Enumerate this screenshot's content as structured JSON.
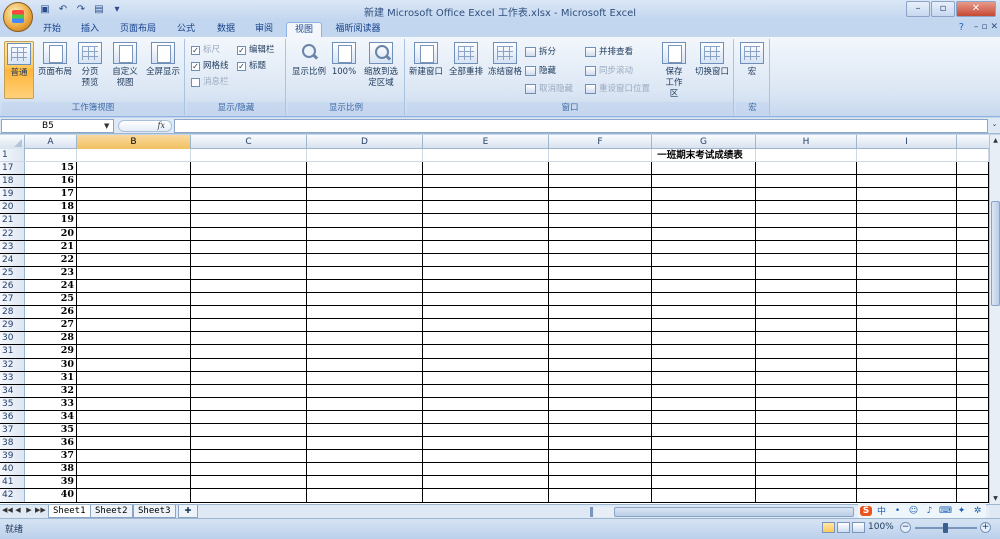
{
  "window": {
    "title": "新建 Microsoft Office Excel 工作表.xlsx - Microsoft Excel",
    "minimize": "–",
    "restore": "▫",
    "close": "✕"
  },
  "qat": {
    "save_icon": "save-icon",
    "undo_glyph": "↶",
    "redo_glyph": "↷",
    "print_glyph": "🖶",
    "more_glyph": "▾"
  },
  "tabs": [
    {
      "label": "开始"
    },
    {
      "label": "插入"
    },
    {
      "label": "页面布局"
    },
    {
      "label": "公式"
    },
    {
      "label": "数据"
    },
    {
      "label": "审阅"
    },
    {
      "label": "视图"
    },
    {
      "label": "福昕阅读器"
    }
  ],
  "active_tab": "视图",
  "help": "?",
  "ribbon": {
    "workbook_views": {
      "label": "工作簿视图",
      "normal": "普通",
      "page_layout": "页面布局",
      "page_break": "分页预览",
      "custom": "自定义视图",
      "fullscreen": "全屏显示"
    },
    "show_hide": {
      "label": "显示/隐藏",
      "ruler": "标尺",
      "gridlines": "网格线",
      "message_bar": "消息栏",
      "formula_bar": "编辑栏",
      "headings": "标题"
    },
    "zoom": {
      "label": "显示比例",
      "zoom": "显示比例",
      "zoom100": "100%",
      "zoom_selection": "缩放到选定区域"
    },
    "window": {
      "label": "窗口",
      "new_window": "新建窗口",
      "arrange_all": "全部重排",
      "freeze": "冻结窗格",
      "split": "拆分",
      "hide": "隐藏",
      "unhide": "取消隐藏",
      "side_by_side": "并排查看",
      "sync_scroll": "同步滚动",
      "reset_position": "重设窗口位置",
      "save_workspace": "保存工作区",
      "switch_windows": "切换窗口"
    },
    "macros": {
      "label": "宏",
      "macros": "宏"
    }
  },
  "formula_bar": {
    "name_box": "B5",
    "fx": "fx",
    "content": ""
  },
  "sheet": {
    "columns": [
      "A",
      "B",
      "C",
      "D",
      "E",
      "F",
      "G",
      "H",
      "I"
    ],
    "selected_column": "B",
    "title_text": "一班期末考试成绩表",
    "rows": [
      {
        "num": "1",
        "value": ""
      },
      {
        "num": "17",
        "value": "15"
      },
      {
        "num": "18",
        "value": "16"
      },
      {
        "num": "19",
        "value": "17"
      },
      {
        "num": "20",
        "value": "18"
      },
      {
        "num": "21",
        "value": "19"
      },
      {
        "num": "22",
        "value": "20"
      },
      {
        "num": "23",
        "value": "21"
      },
      {
        "num": "24",
        "value": "22"
      },
      {
        "num": "25",
        "value": "23"
      },
      {
        "num": "26",
        "value": "24"
      },
      {
        "num": "27",
        "value": "25"
      },
      {
        "num": "28",
        "value": "26"
      },
      {
        "num": "29",
        "value": "27"
      },
      {
        "num": "30",
        "value": "28"
      },
      {
        "num": "31",
        "value": "29"
      },
      {
        "num": "32",
        "value": "30"
      },
      {
        "num": "33",
        "value": "31"
      },
      {
        "num": "34",
        "value": "32"
      },
      {
        "num": "35",
        "value": "33"
      },
      {
        "num": "36",
        "value": "34"
      },
      {
        "num": "37",
        "value": "35"
      },
      {
        "num": "38",
        "value": "36"
      },
      {
        "num": "39",
        "value": "37"
      },
      {
        "num": "40",
        "value": "38"
      },
      {
        "num": "41",
        "value": "39"
      },
      {
        "num": "42",
        "value": "40"
      }
    ]
  },
  "sheet_tabs": [
    {
      "label": "Sheet1",
      "active": true
    },
    {
      "label": "Sheet2",
      "active": false
    },
    {
      "label": "Sheet3",
      "active": false
    }
  ],
  "status": {
    "ready": "就绪",
    "zoom": "100%"
  },
  "ime": {
    "logo": "S",
    "chinese": "中"
  }
}
